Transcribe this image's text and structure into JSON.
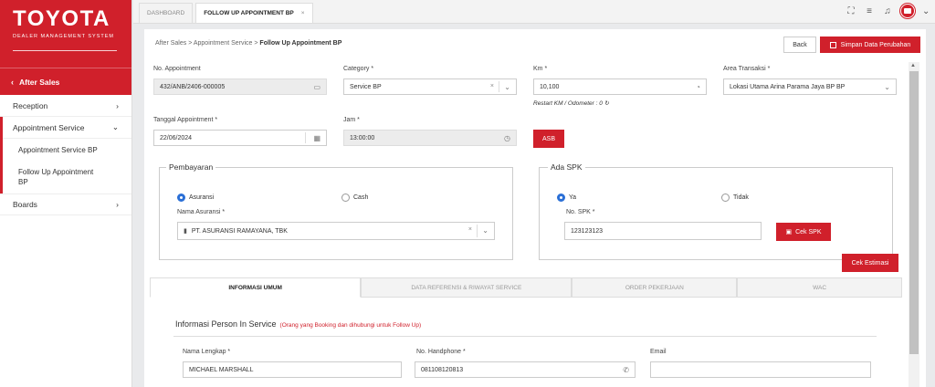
{
  "brand": {
    "logo": "TOYOTA",
    "subtitle": "DEALER MANAGEMENT SYSTEM"
  },
  "sidebar": {
    "header": "After Sales",
    "items": [
      {
        "label": "Reception"
      },
      {
        "label": "Appointment Service"
      },
      {
        "label": "Boards"
      }
    ],
    "subitems": [
      {
        "label": "Appointment Service BP"
      },
      {
        "label": "Follow Up Appointment BP"
      }
    ]
  },
  "tabs": [
    {
      "label": "DASHBOARD"
    },
    {
      "label": "FOLLOW UP APPOINTMENT BP"
    }
  ],
  "breadcrumb": {
    "part1": "After Sales",
    "part2": "Appointment Service",
    "current": "Follow Up Appointment BP"
  },
  "actions": {
    "back": "Back",
    "save": "Simpan Data Perubahan"
  },
  "form": {
    "no_appointment": {
      "label": "No. Appointment",
      "value": "432/ANB/2406-000005"
    },
    "category": {
      "label": "Category *",
      "value": "Service BP"
    },
    "km": {
      "label": "Km *",
      "value": "10,100",
      "note": "Restart KM / Odometer : 0"
    },
    "area": {
      "label": "Area Transaksi *",
      "value": "Lokasi Utama Arina Parama Jaya BP BP"
    },
    "tanggal": {
      "label": "Tanggal Appointment *",
      "value": "22/06/2024"
    },
    "jam": {
      "label": "Jam *",
      "value": "13:00:00"
    },
    "asb": "ASB"
  },
  "pembayaran": {
    "title": "Pembayaran",
    "opt1": "Asuransi",
    "opt2": "Cash",
    "nama_label": "Nama Asuransi *",
    "nama_value": "PT. ASURANSI RAMAYANA, TBK"
  },
  "spk": {
    "title": "Ada SPK",
    "opt1": "Ya",
    "opt2": "Tidak",
    "no_label": "No. SPK *",
    "no_value": "123123123",
    "cek": "Cek SPK"
  },
  "cek_estimasi": "Cek Estimasi",
  "info_tabs": [
    "INFORMASI UMUM",
    "DATA REFERENSI & RIWAYAT SERVICE",
    "ORDER PEKERJAAN",
    "WAC"
  ],
  "person": {
    "title": "Informasi Person In Service",
    "hint": "(Orang yang Booking dan dihubungi untuk Follow Up)",
    "nama_label": "Nama Lengkap *",
    "nama_value": "MICHAEL MARSHALL",
    "hp_label": "No. Handphone *",
    "hp_value": "081108120813",
    "email_label": "Email",
    "email_value": ""
  }
}
